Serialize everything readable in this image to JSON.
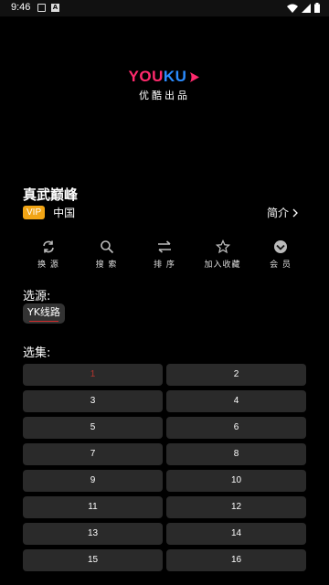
{
  "status_bar": {
    "time": "9:46",
    "icons": [
      "image-icon",
      "a-icon",
      "wifi-icon",
      "signal-icon",
      "battery-icon"
    ]
  },
  "player": {
    "logo_text": "YOUKU",
    "logo_subtitle": "优酷出品"
  },
  "show": {
    "title": "真武巅峰",
    "vip_badge": "VIP",
    "region": "中国",
    "intro_label": "简介"
  },
  "actions": [
    {
      "label": "换 源",
      "icon": "refresh-icon"
    },
    {
      "label": "搜 索",
      "icon": "search-icon"
    },
    {
      "label": "排 序",
      "icon": "sort-icon"
    },
    {
      "label": "加入收藏",
      "icon": "star-icon"
    },
    {
      "label": "会 员",
      "icon": "vip-member-icon"
    }
  ],
  "source": {
    "label": "选源:",
    "selected": "YK线路"
  },
  "episodes": {
    "label": "选集:",
    "items": [
      "1",
      "2",
      "3",
      "4",
      "5",
      "6",
      "7",
      "8",
      "9",
      "10",
      "11",
      "12",
      "13",
      "14",
      "15",
      "16"
    ],
    "active": "1"
  },
  "colors": {
    "background": "#000000",
    "vip": "#f2a515",
    "active_episode": "#b5362f",
    "episode_bg": "#2a2a2a",
    "source_underline": "#d12b2b"
  }
}
